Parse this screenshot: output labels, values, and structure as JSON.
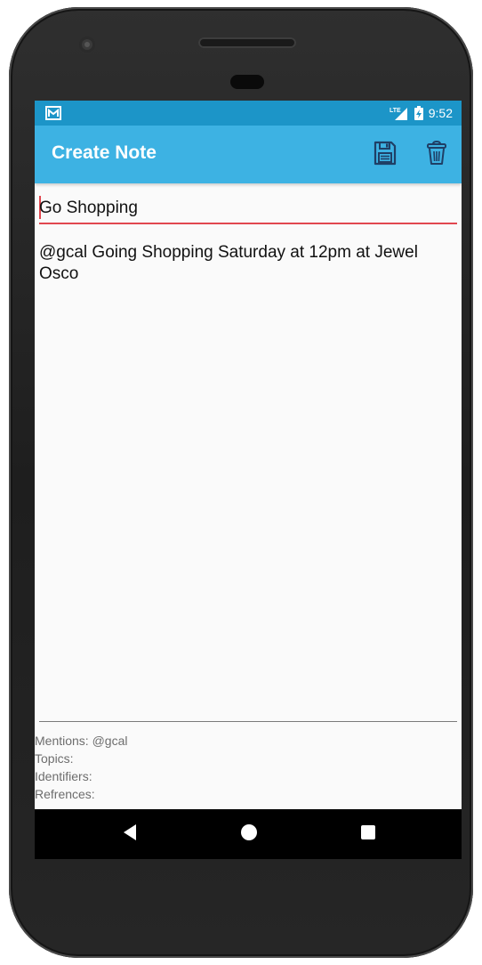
{
  "status_bar": {
    "time": "9:52",
    "network": "LTE",
    "notification_icon": "gmail-icon"
  },
  "app_bar": {
    "title": "Create Note",
    "actions": [
      {
        "icon": "save-icon"
      },
      {
        "icon": "trash-icon"
      }
    ]
  },
  "note": {
    "title": "Go Shopping",
    "body": "@gcal Going Shopping Saturday at 12pm at Jewel Osco"
  },
  "metadata": {
    "mentions": "Mentions: @gcal",
    "topics": "Topics:",
    "identifiers": "Identifiers:",
    "references": "Refrences:"
  },
  "nav": {
    "back": "back-icon",
    "home": "home-icon",
    "recents": "recents-icon"
  },
  "colors": {
    "status_bar": "#1c95c8",
    "app_bar": "#3db2e3",
    "accent": "#e1474f"
  }
}
